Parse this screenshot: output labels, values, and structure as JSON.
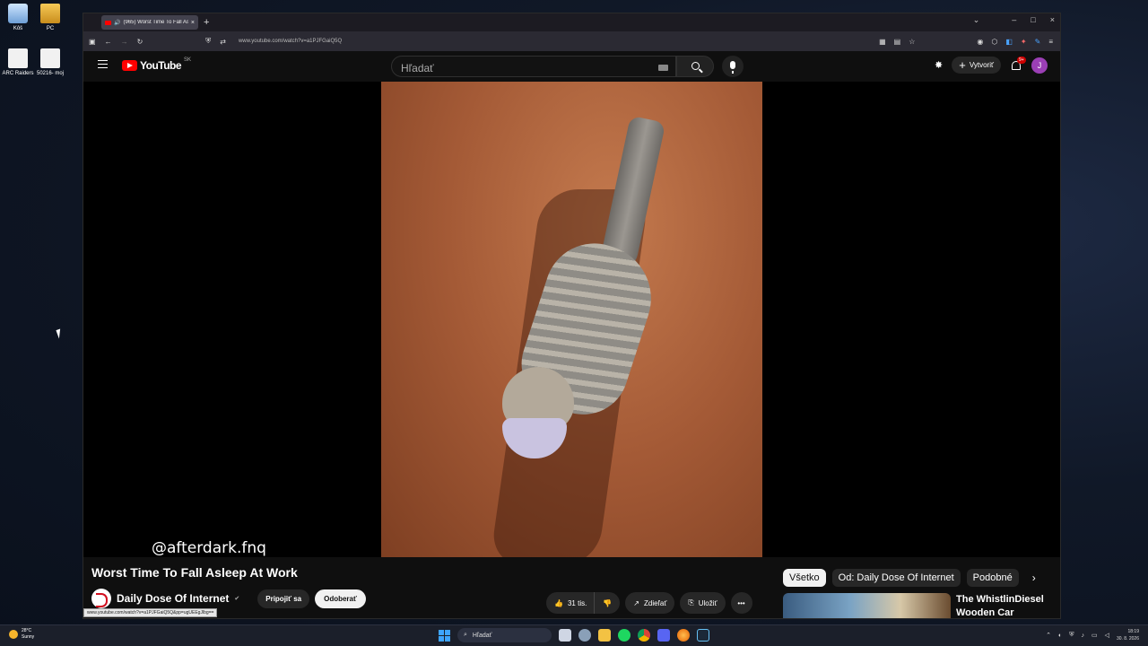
{
  "desktop": {
    "icons": [
      {
        "label": "Kôš",
        "icon": "recycle-bin-icon"
      },
      {
        "label": "PC",
        "icon": "folder-icon"
      },
      {
        "label": "ARC Raiders",
        "icon": "file-icon"
      },
      {
        "label": "50216- moj",
        "icon": "file-icon"
      }
    ]
  },
  "browser": {
    "tab_title": "(965) Worst Time To Fall As",
    "tab_close": "×",
    "new_tab": "+",
    "url": "www.youtube.com/watch?v=a1PJFGaiQ5Q",
    "status_url": "www.youtube.com/watch?v=a1PJFGaiQ5Q&pp=ugUEEgJlbg==",
    "window_controls": {
      "tabs_list": "⌄",
      "minimize": "–",
      "maximize": "□",
      "close": "×"
    }
  },
  "youtube": {
    "brand": "YouTube",
    "region": "SK",
    "search_placeholder": "Hľadať",
    "create_label": "Vytvoriť",
    "notifications_badge": "9+",
    "avatar_letter": "J",
    "watermark": "@afterdark.fnq",
    "video_title": "Worst Time To Fall Asleep At Work",
    "channel_name": "Daily Dose Of Internet",
    "join_label": "Pripojiť sa",
    "subscribe_label": "Odoberať",
    "like_count": "31 tis.",
    "share_label": "Zdieľať",
    "save_label": "Uložiť",
    "more_label": "•••",
    "chips": [
      "Všetko",
      "Od: Daily Dose Of Internet",
      "Podobné"
    ],
    "chip_next": "›",
    "related_title": "The WhistlinDiesel Wooden Car"
  },
  "taskbar": {
    "temperature": "28°C",
    "weather": "Sunny",
    "search_label": "Hľadať",
    "time": "18:19",
    "date": "30. 8. 2026"
  },
  "colors": {
    "accent_red": "#ff0000",
    "avatar": "#9b3fb5",
    "taskbar": "#1b1f2a"
  }
}
